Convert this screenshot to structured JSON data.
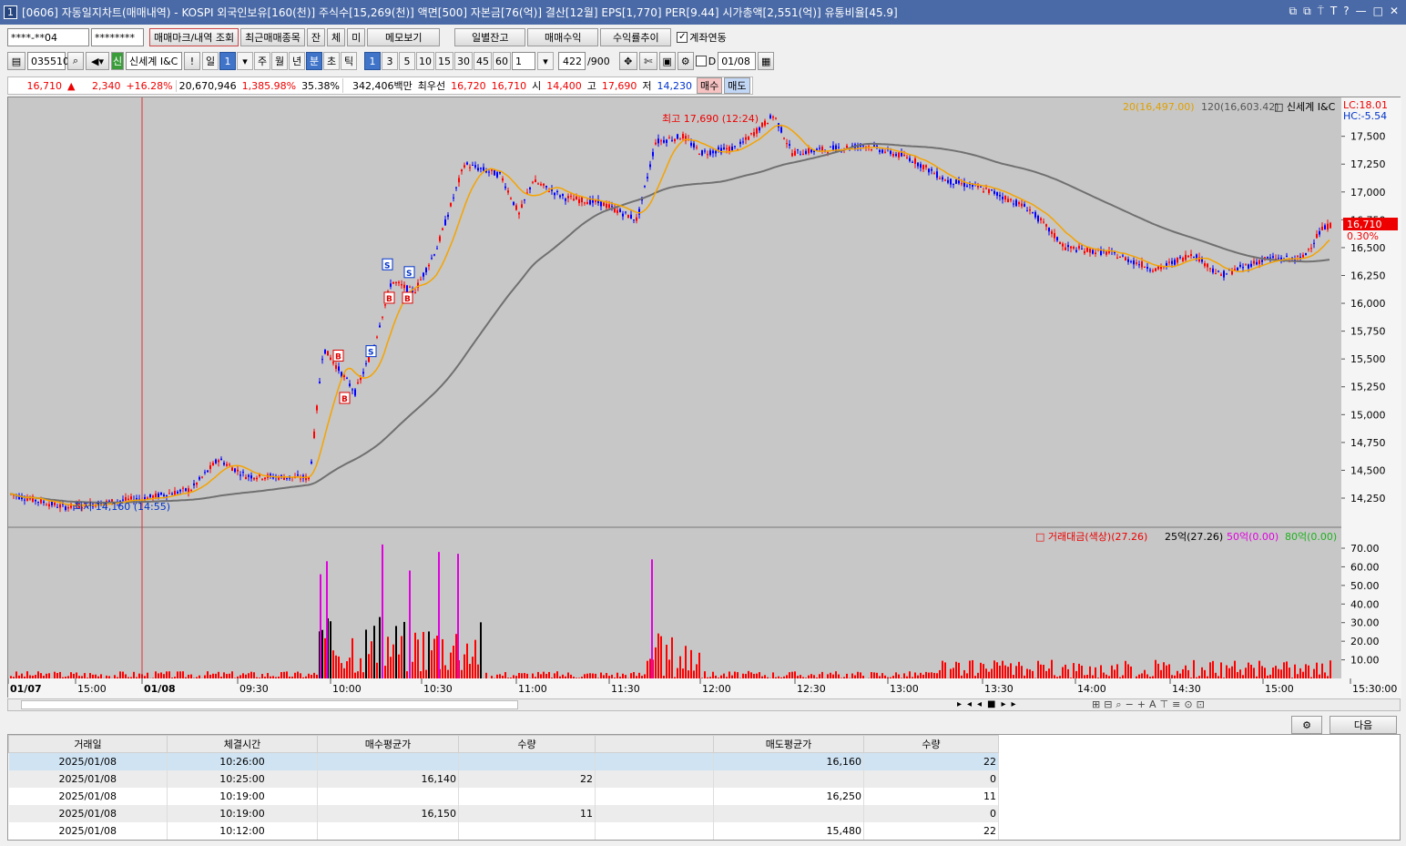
{
  "window": {
    "title": "[0606] 자동일지차트(매매내역) - KOSPI 외국인보유[160(천)] 주식수[15,269(천)] 액면[500] 자본금[76(억)] 결산[12월] EPS[1,770] PER[9.44] 시가총액[2,551(억)] 유통비율[45.9]",
    "num": "1",
    "controls": [
      "⧉",
      "⧉",
      "⍑",
      "T",
      "?",
      "—",
      "□",
      "✕"
    ]
  },
  "toolbar1": {
    "account": "****-**04",
    "password": "********",
    "mark_btn": "매매마크/내역 조회",
    "recent_btn": "최근매매종목",
    "jan": "잔",
    "che": "체",
    "mi": "미",
    "memo_btn": "메모보기",
    "daily_btn": "일별잔고",
    "profit_btn": "매매수익",
    "rate_btn": "수익률추이",
    "link_label": "계좌연동"
  },
  "toolbar2": {
    "code": "035510",
    "sin": "신",
    "name": "신세계 I&C",
    "excl": "!",
    "periods": [
      "일",
      "1",
      "주",
      "월",
      "년",
      "분",
      "초",
      "틱"
    ],
    "minutes": [
      "1",
      "3",
      "5",
      "10",
      "15",
      "30",
      "45",
      "60"
    ],
    "unit": "1",
    "count": "422",
    "count_max": "/900",
    "d_label": "D",
    "date": "01/08"
  },
  "quote": {
    "price": "16,710",
    "arrow": "▲",
    "change": "2,340",
    "rate": "+16.28%",
    "volume": "20,670,946",
    "vol_rate": "1,385.98%",
    "turnover": "35.38%",
    "amount": "342,406백만",
    "best_label": "최우선",
    "ask": "16,720",
    "bid": "16,710",
    "open_label": "시",
    "open": "14,400",
    "high_label": "고",
    "high": "17,690",
    "low_label": "저",
    "low": "14,230",
    "buy_btn": "매수",
    "sell_btn": "매도"
  },
  "chart": {
    "legend_ma20": "20(16,497.00)",
    "legend_ma120": "120(16,603.42)",
    "legend_name": "□ 신세계 I&C",
    "lc": "LC:18.01",
    "hc": "HC:-5.54",
    "high_label": "최고 17,690 (12:24)",
    "low_label": "최저 14,160 (14:55)",
    "price_badge": "16,710",
    "price_pct": "0.30%",
    "y_ticks": [
      "17,500",
      "17,250",
      "17,000",
      "16,750",
      "16,500",
      "16,250",
      "16,000",
      "15,750",
      "15,500",
      "15,250",
      "15,000",
      "14,750",
      "14,500",
      "14,250"
    ],
    "vol_legend": {
      "main": "□ 거래대금(색상)(27.26)",
      "s25": "25억(27.26)",
      "s50": "50억(0.00)",
      "s80": "80억(0.00)"
    },
    "vol_ticks": [
      "70.00",
      "60.00",
      "50.00",
      "40.00",
      "30.00",
      "20.00",
      "10.00"
    ],
    "x_labels": [
      "01/07",
      "15:00",
      "01/08",
      "09:30",
      "10:00",
      "10:30",
      "11:00",
      "11:30",
      "12:00",
      "12:30",
      "13:00",
      "13:30",
      "14:00",
      "14:30",
      "15:00",
      "15:30:00"
    ],
    "colors": {
      "up": "#ff0000",
      "down": "#0000ff",
      "ma20": "#f5a300",
      "ma120": "#707070",
      "bg": "#c7c7c7"
    }
  },
  "bottom": {
    "next_btn": "다음"
  },
  "table": {
    "headers": [
      "거래일",
      "체결시간",
      "매수평균가",
      "수량",
      "",
      "매도평균가",
      "수량"
    ],
    "rows": [
      [
        "2025/01/08",
        "10:26:00",
        "",
        "",
        "",
        "16,160",
        "22"
      ],
      [
        "2025/01/08",
        "10:25:00",
        "16,140",
        "22",
        "",
        "",
        "0"
      ],
      [
        "2025/01/08",
        "10:19:00",
        "",
        "",
        "",
        "16,250",
        "11"
      ],
      [
        "2025/01/08",
        "10:19:00",
        "16,150",
        "11",
        "",
        "",
        "0"
      ],
      [
        "2025/01/08",
        "10:12:00",
        "",
        "",
        "",
        "15,480",
        "22"
      ]
    ]
  }
}
